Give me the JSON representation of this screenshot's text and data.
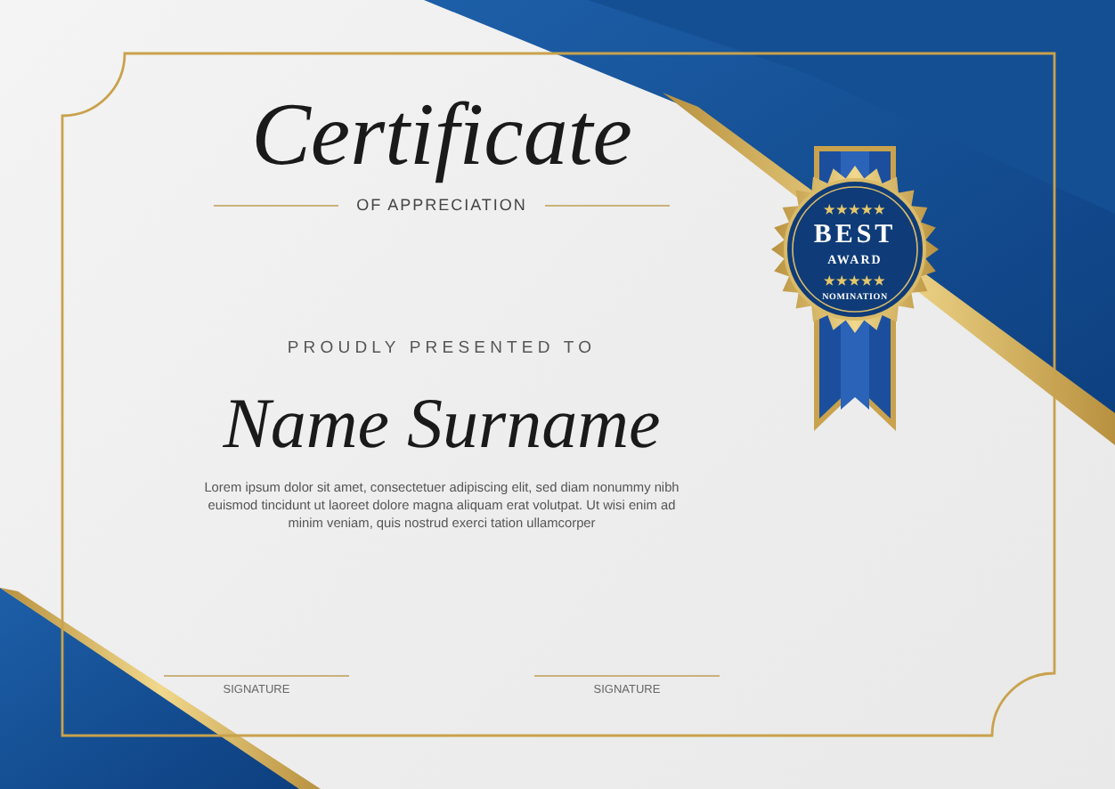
{
  "certificate": {
    "title": "Certificate",
    "subtitle": "OF APPRECIATION",
    "presented_to": "PROUDLY PRESENTED TO",
    "recipient": "Name Surname",
    "body": "Lorem ipsum dolor sit amet, consectetuer adipiscing elit, sed diam nonummy nibh euismod tincidunt ut laoreet dolore magna aliquam erat volutpat. Ut wisi enim ad minim veniam, quis nostrud exerci tation ullamcorper"
  },
  "badge": {
    "stars_top": "★★★★★",
    "headline": "BEST",
    "subline": "AWARD",
    "stars_bottom": "★★★★★",
    "caption": "NOMINATION"
  },
  "signatures": [
    {
      "label": "SIGNATURE"
    },
    {
      "label": "SIGNATURE"
    }
  ]
}
